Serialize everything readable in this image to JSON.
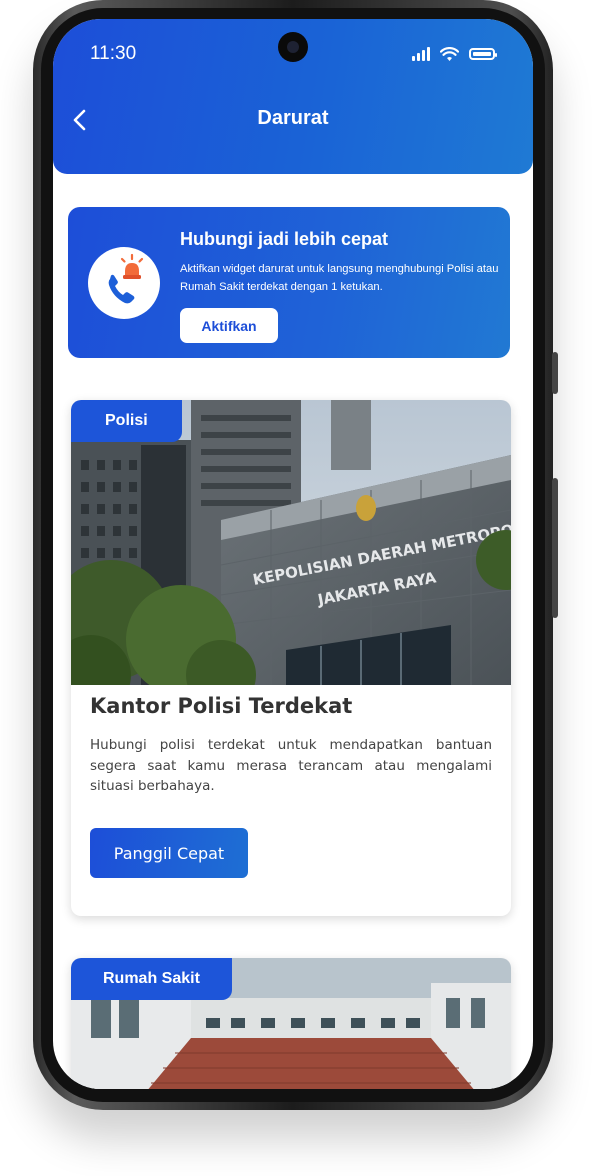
{
  "status_bar": {
    "time": "11:30"
  },
  "header": {
    "title": "Darurat"
  },
  "promo": {
    "title": "Hubungi jadi lebih cepat",
    "description": "Aktifkan widget darurat untuk langsung menghubungi Polisi atau Rumah Sakit terdekat dengan 1 ketukan.",
    "button_label": "Aktifkan",
    "icon": "phone-alarm-icon"
  },
  "cards": [
    {
      "badge": "Polisi",
      "image_sign_line1": "KEPOLISIAN DAERAH METROPOLITAN",
      "image_sign_line2": "JAKARTA RAYA",
      "title": "Kantor Polisi Terdekat",
      "description": "Hubungi polisi terdekat untuk mendapatkan bantuan segera saat kamu merasa terancam atau mengalami situasi berbahaya.",
      "button_label": "Panggil Cepat"
    },
    {
      "badge": "Rumah Sakit"
    }
  ],
  "colors": {
    "primary": "#1d4ed8",
    "primary_light": "#1f7ad4",
    "text_dark": "#333333"
  }
}
